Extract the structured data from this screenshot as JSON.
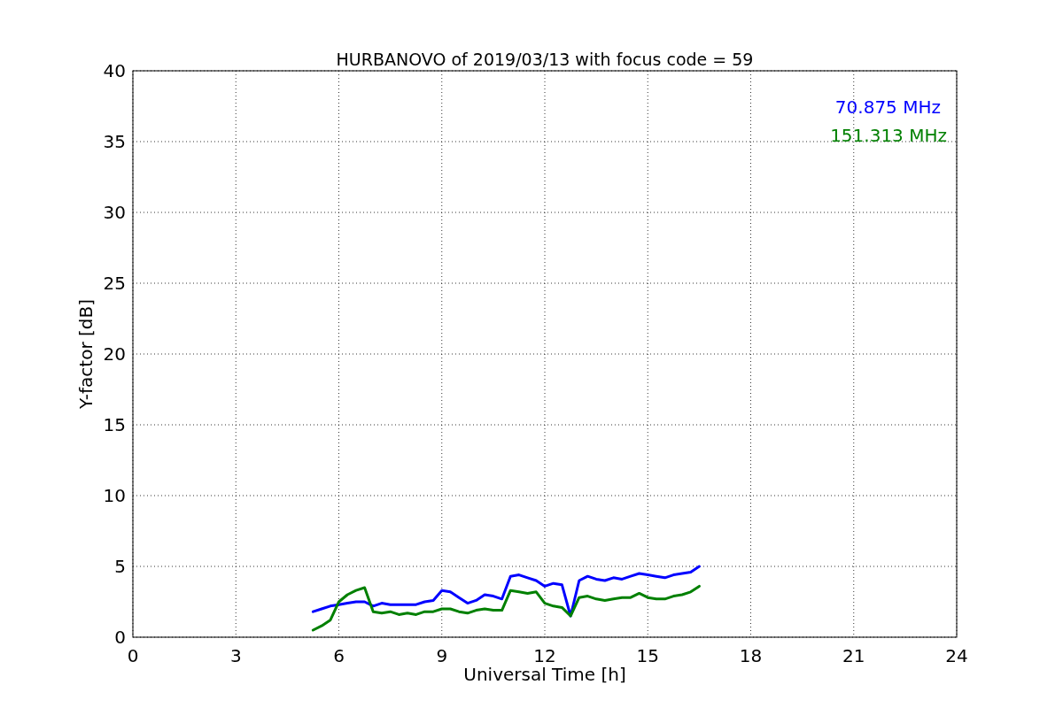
{
  "chart_data": {
    "type": "line",
    "title": "HURBANOVO of 2019/03/13 with focus code = 59",
    "xlabel": "Universal Time [h]",
    "ylabel": "Y-factor [dB]",
    "x": [
      5.25,
      5.5,
      5.75,
      6,
      6.25,
      6.5,
      6.75,
      7,
      7.25,
      7.5,
      7.75,
      8,
      8.25,
      8.5,
      8.75,
      9,
      9.25,
      9.5,
      9.75,
      10,
      10.25,
      10.5,
      10.75,
      11,
      11.25,
      11.5,
      11.75,
      12,
      12.25,
      12.5,
      12.75,
      13,
      13.25,
      13.5,
      13.75,
      14,
      14.25,
      14.5,
      14.75,
      15,
      15.25,
      15.5,
      15.75,
      16,
      16.25,
      16.5
    ],
    "series": [
      {
        "name": "70.875 MHz",
        "color": "#0000ff",
        "values": [
          1.8,
          2,
          2.2,
          2.3,
          2.4,
          2.5,
          2.5,
          2.2,
          2.4,
          2.3,
          2.3,
          2.3,
          2.3,
          2.5,
          2.6,
          3.3,
          3.2,
          2.8,
          2.4,
          2.6,
          3,
          2.9,
          2.7,
          4.3,
          4.4,
          4.2,
          4,
          3.6,
          3.8,
          3.7,
          1.5,
          4,
          4.3,
          4.1,
          4,
          4.2,
          4.1,
          4.3,
          4.5,
          4.4,
          4.3,
          4.2,
          4.4,
          4.5,
          4.6,
          5
        ]
      },
      {
        "name": "151.313 MHz",
        "color": "#008000",
        "values": [
          0.5,
          0.8,
          1.2,
          2.5,
          3,
          3.3,
          3.5,
          1.8,
          1.7,
          1.8,
          1.6,
          1.7,
          1.6,
          1.8,
          1.8,
          2,
          2,
          1.8,
          1.7,
          1.9,
          2,
          1.9,
          1.9,
          3.3,
          3.2,
          3.1,
          3.2,
          2.4,
          2.2,
          2.1,
          1.5,
          2.8,
          2.9,
          2.7,
          2.6,
          2.7,
          2.8,
          2.8,
          3.1,
          2.8,
          2.7,
          2.7,
          2.9,
          3,
          3.2,
          3.6
        ]
      }
    ],
    "xlim": [
      0,
      24
    ],
    "ylim": [
      0,
      40
    ],
    "xticks": [
      0,
      3,
      6,
      9,
      12,
      15,
      18,
      21,
      24
    ],
    "yticks": [
      0,
      5,
      10,
      15,
      20,
      25,
      30,
      35,
      40
    ],
    "grid": true
  }
}
